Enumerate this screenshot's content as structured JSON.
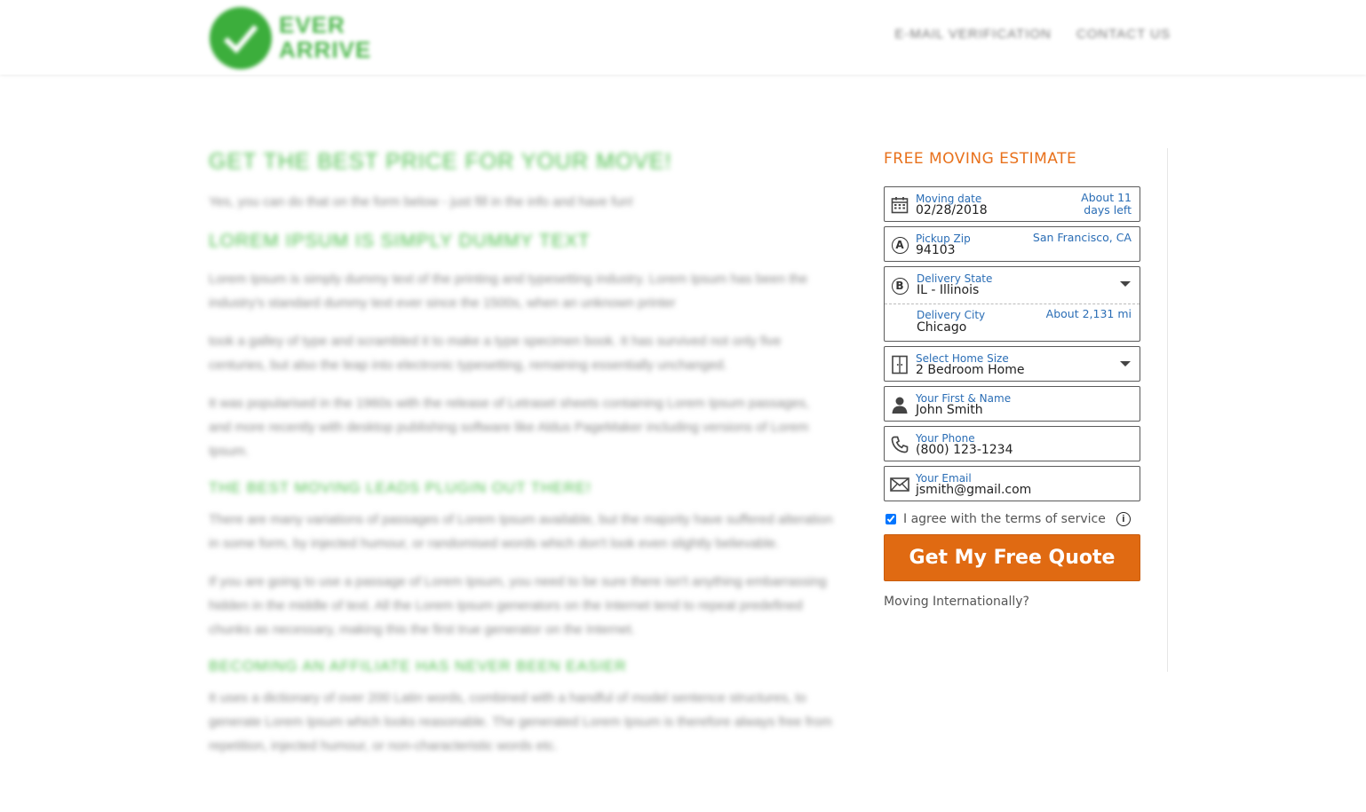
{
  "header": {
    "logo_text_line1": "EVER",
    "logo_text_line2": "ARRIVE",
    "nav": [
      "E-MAIL VERIFICATION",
      "CONTACT US"
    ]
  },
  "content": {
    "title": "GET THE BEST PRICE FOR YOUR MOVE!",
    "lead": "Yes, you can do that on the form below - just fill in the info and have fun!",
    "section1_heading": "LOREM IPSUM IS SIMPLY DUMMY TEXT",
    "p1": "Lorem Ipsum is simply dummy text of the printing and typesetting industry. Lorem Ipsum has been the industry's standard dummy text ever since the 1500s, when an unknown printer",
    "p2": "took a galley of type and scrambled it to make a type specimen book. It has survived not only five centuries, but also the leap into electronic typesetting, remaining essentially unchanged.",
    "p3": "It was popularised in the 1960s with the release of Letraset sheets containing Lorem Ipsum passages, and more recently with desktop publishing software like Aldus PageMaker including versions of Lorem Ipsum.",
    "section2_heading": "THE BEST MOVING LEADS PLUGIN OUT THERE!",
    "p4": "There are many variations of passages of Lorem Ipsum available, but the majority have suffered alteration in some form, by injected humour, or randomised words which don't look even slightly believable.",
    "p5": "If you are going to use a passage of Lorem Ipsum, you need to be sure there isn't anything embarrassing hidden in the middle of text. All the Lorem Ipsum generators on the Internet tend to repeat predefined chunks as necessary, making this the first true generator on the Internet.",
    "section3_heading": "BECOMING AN AFFILIATE HAS NEVER BEEN EASIER",
    "p6": "It uses a dictionary of over 200 Latin words, combined with a handful of model sentence structures, to generate Lorem Ipsum which looks reasonable. The generated Lorem Ipsum is therefore always free from repetition, injected humour, or non-characteristic words etc."
  },
  "form": {
    "title": "FREE MOVING ESTIMATE",
    "moving_date": {
      "label": "Moving date",
      "value": "02/28/2018",
      "hint_line1": "About 11",
      "hint_line2": "days left",
      "icon": "calendar-icon"
    },
    "pickup_zip": {
      "label": "Pickup Zip",
      "value": "94103",
      "hint": "San Francisco, CA",
      "icon_letter": "A"
    },
    "delivery_state": {
      "label": "Delivery State",
      "value": "IL - Illinois",
      "icon_letter": "B"
    },
    "delivery_city": {
      "label": "Delivery City",
      "value": "Chicago",
      "hint": "About 2,131 mi"
    },
    "home_size": {
      "label": "Select Home Size",
      "value": "2 Bedroom Home",
      "icon": "door-icon"
    },
    "name": {
      "label": "Your First & Name",
      "value": "John Smith",
      "icon": "person-icon"
    },
    "phone": {
      "label": "Your Phone",
      "value": "(800) 123-1234",
      "icon": "phone-icon"
    },
    "email": {
      "label": "Your Email",
      "value": "jsmith@gmail.com",
      "icon": "envelope-icon"
    },
    "agree_text": "I agree with the terms of service",
    "agree_checked": true,
    "submit_label": "Get My Free Quote",
    "intl_link": "Moving Internationally?"
  },
  "colors": {
    "accent_orange": "#e06a12",
    "label_blue": "#2a6db5",
    "brand_green": "#4dbf4d"
  }
}
